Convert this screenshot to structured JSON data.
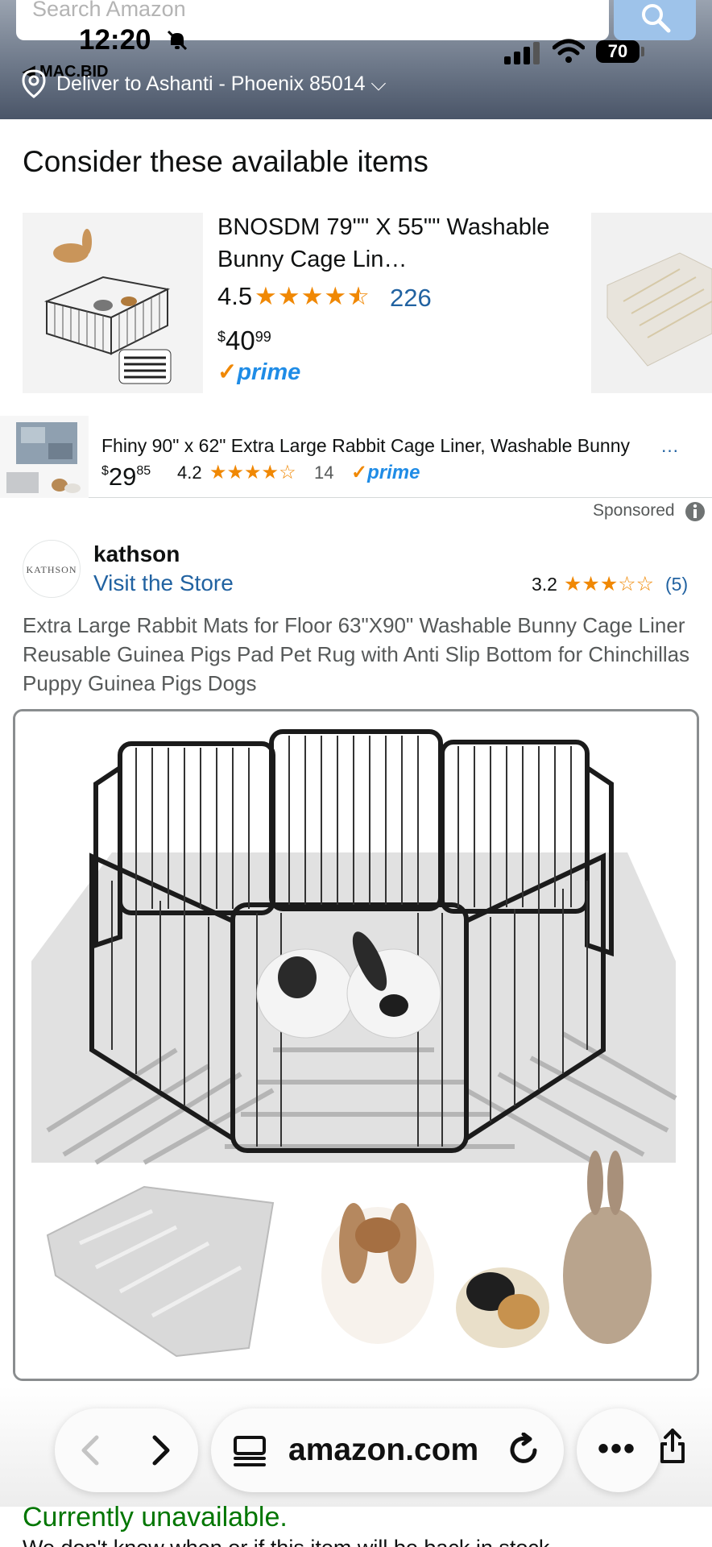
{
  "search": {
    "placeholder": "Search Amazon"
  },
  "status_bar": {
    "time": "12:20",
    "back_app": "◀ MAC.BID",
    "battery": "70"
  },
  "delivery": {
    "text": "Deliver to Ashanti - Phoenix 85014 ⌵"
  },
  "consider": {
    "title": "Consider these available items",
    "card": {
      "title": "BNOSDM 79\"\" X 55\"\" Washable Bunny Cage Lin…",
      "rating": "4.5",
      "stars": 4.5,
      "review_count": "226",
      "price_symbol": "$",
      "price_whole": "40",
      "price_fraction": "99",
      "prime": "prime"
    }
  },
  "banner": {
    "title": "Fhiny 90\" x 62\" Extra Large Rabbit Cage Liner, Washable Bunny",
    "more": "…",
    "price_symbol": "$",
    "price_whole": "29",
    "price_fraction": "85",
    "rating": "4.2",
    "stars": 4.2,
    "review_count": "14",
    "prime": "prime"
  },
  "sponsored": {
    "label": "Sponsored"
  },
  "store": {
    "logo_text": "KATHSON",
    "brand": "kathson",
    "visit_label": "Visit the Store",
    "rating": "3.2",
    "stars": 3.2,
    "review_count": "(5)"
  },
  "product": {
    "title": "Extra Large Rabbit Mats for Floor 63\"X90\" Washable Bunny Cage Liner Reusable Guinea Pigs Pad Pet Rug with Anti Slip Bottom for Chinchillas Puppy Guinea Pigs Dogs"
  },
  "browser": {
    "url": "amazon.com",
    "more": "•••"
  },
  "availability": {
    "status": "Currently unavailable.",
    "note": "We don't know when or if this item will be back in stock."
  },
  "colors": {
    "accent": "#f08804",
    "link": "#2162a1",
    "prime": "#1f8ce6",
    "available": "#007600"
  },
  "icons": [
    "search-icon",
    "bell-slash-icon",
    "signal-icon",
    "wifi-icon",
    "location-icon",
    "info-icon",
    "back-arrow-icon",
    "forward-arrow-icon",
    "tabs-icon",
    "reload-icon",
    "share-icon"
  ]
}
